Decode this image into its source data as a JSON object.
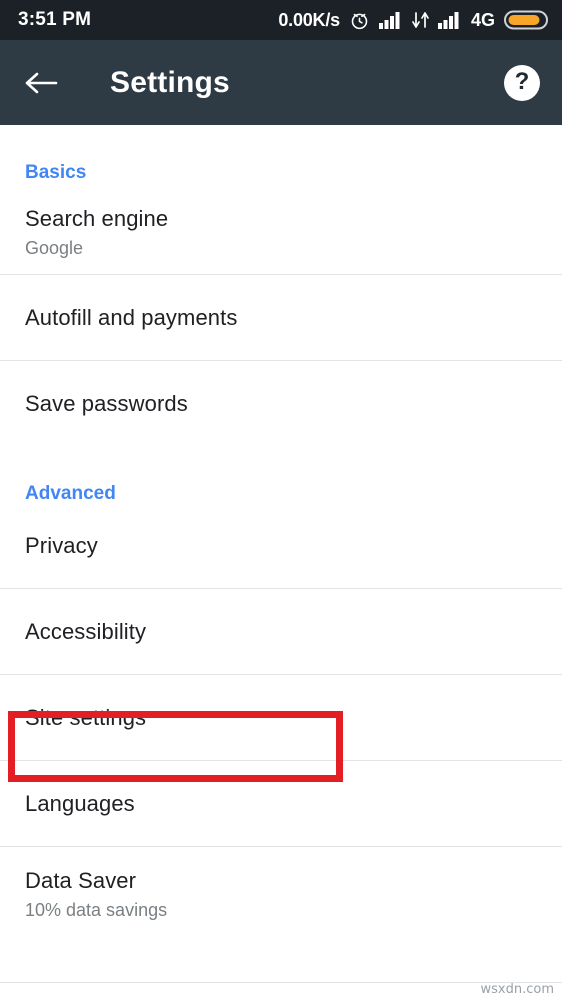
{
  "status_bar": {
    "time": "3:51 PM",
    "network_speed": "0.00K/s",
    "network_type": "4G",
    "icons": [
      "alarm-clock-icon",
      "signal-bars-icon",
      "data-transfer-icon",
      "signal-bars-icon",
      "battery-icon"
    ],
    "background_color": "#1b2127",
    "battery_color": "#f7a62a"
  },
  "app_bar": {
    "back_label": "back-arrow",
    "title": "Settings",
    "help_label": "?",
    "background_color": "#2f3b44"
  },
  "sections": [
    {
      "header": "Basics",
      "items": [
        {
          "title": "Search engine",
          "subtitle": "Google"
        },
        {
          "title": "Autofill and payments",
          "subtitle": ""
        },
        {
          "title": "Save passwords",
          "subtitle": ""
        }
      ]
    },
    {
      "header": "Advanced",
      "items": [
        {
          "title": "Privacy",
          "subtitle": ""
        },
        {
          "title": "Accessibility",
          "subtitle": ""
        },
        {
          "title": "Site settings",
          "subtitle": ""
        },
        {
          "title": "Languages",
          "subtitle": ""
        },
        {
          "title": "Data Saver",
          "subtitle": "10% data savings"
        }
      ]
    }
  ],
  "annotation": {
    "target": "Site settings",
    "color": "#e31e24"
  },
  "watermark": "wsxdn.com",
  "accent_color": "#4285f4"
}
